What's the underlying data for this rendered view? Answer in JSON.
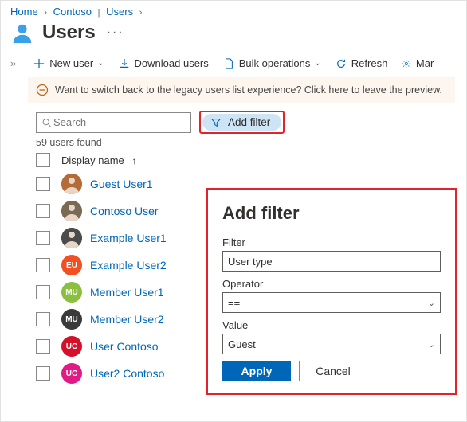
{
  "breadcrumb": {
    "home": "Home",
    "tenant": "Contoso",
    "section": "Users"
  },
  "page": {
    "title": "Users"
  },
  "toolbar": {
    "newUser": "New user",
    "download": "Download users",
    "bulk": "Bulk operations",
    "refresh": "Refresh",
    "manage": "Mar"
  },
  "notice": {
    "text": "Want to switch back to the legacy users list experience? Click here to leave the preview."
  },
  "search": {
    "placeholder": "Search",
    "addFilter": "Add filter"
  },
  "count": "59 users found",
  "columns": {
    "displayName": "Display name"
  },
  "users": [
    {
      "name": "Guest User1",
      "initials": "",
      "color": "#b36b38",
      "img": "photo1"
    },
    {
      "name": "Contoso User",
      "initials": "",
      "color": "#7a6a55",
      "img": "photo2"
    },
    {
      "name": "Example User1",
      "initials": "",
      "color": "#4b4b4b",
      "img": "photo3"
    },
    {
      "name": "Example User2",
      "initials": "EU",
      "color": "#f25022",
      "img": ""
    },
    {
      "name": "Member User1",
      "initials": "MU",
      "color": "#8bbf3f",
      "img": ""
    },
    {
      "name": "Member User2",
      "initials": "MU",
      "color": "#3a3a3a",
      "img": ""
    },
    {
      "name": "User Contoso",
      "initials": "UC",
      "color": "#d4102a",
      "img": ""
    },
    {
      "name": "User2 Contoso",
      "initials": "UC",
      "color": "#e01b84",
      "img": ""
    }
  ],
  "filterPanel": {
    "title": "Add filter",
    "filterLabel": "Filter",
    "filterValue": "User type",
    "operatorLabel": "Operator",
    "operatorValue": "==",
    "valueLabel": "Value",
    "valueValue": "Guest",
    "apply": "Apply",
    "cancel": "Cancel"
  }
}
